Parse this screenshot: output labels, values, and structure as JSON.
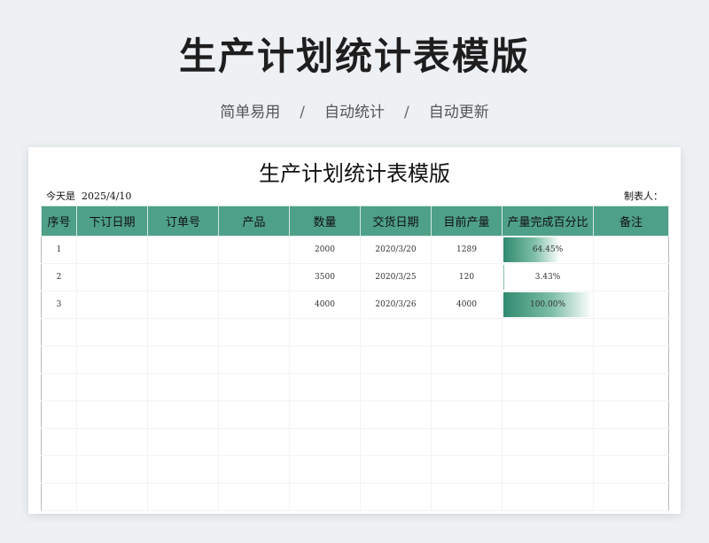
{
  "banner": {
    "title": "生产计划统计表模版",
    "tags": [
      "简单易用",
      "自动统计",
      "自动更新"
    ],
    "separator": "/"
  },
  "sheet": {
    "title": "生产计划统计表模版",
    "today_label": "今天是",
    "today_date": "2025/4/10",
    "maker_label": "制表人：",
    "header_color": "#4ea088",
    "columns": [
      "序号",
      "下订日期",
      "订单号",
      "产品",
      "数量",
      "交货日期",
      "目前产量",
      "产量完成百分比",
      "备注"
    ],
    "rows": [
      {
        "seq": "1",
        "order_date": "",
        "order_no": "",
        "product": "",
        "qty": "2000",
        "delivery": "2020/3/20",
        "current": "1289",
        "pct": 0.6445,
        "pct_label": "64.45%",
        "note": ""
      },
      {
        "seq": "2",
        "order_date": "",
        "order_no": "",
        "product": "",
        "qty": "3500",
        "delivery": "2020/3/25",
        "current": "120",
        "pct": 0.0343,
        "pct_label": "3.43%",
        "note": ""
      },
      {
        "seq": "3",
        "order_date": "",
        "order_no": "",
        "product": "",
        "qty": "4000",
        "delivery": "2020/3/26",
        "current": "4000",
        "pct": 1.0,
        "pct_label": "100.00%",
        "note": ""
      }
    ]
  }
}
